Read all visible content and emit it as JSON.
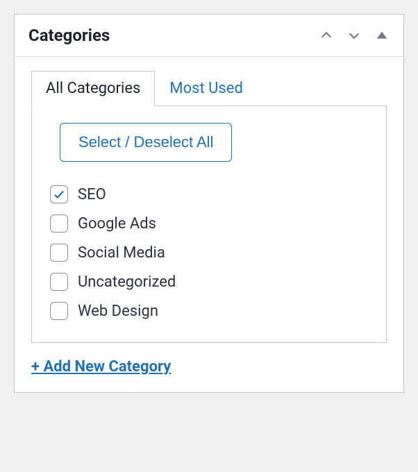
{
  "panel": {
    "title": "Categories"
  },
  "tabs": {
    "all": "All Categories",
    "most_used": "Most Used"
  },
  "select_all_label": "Select / Deselect All",
  "categories": [
    {
      "label": "SEO",
      "checked": true
    },
    {
      "label": "Google Ads",
      "checked": false
    },
    {
      "label": "Social Media",
      "checked": false
    },
    {
      "label": "Uncategorized",
      "checked": false
    },
    {
      "label": "Web Design",
      "checked": false
    }
  ],
  "add_new_label": "+ Add New Category"
}
